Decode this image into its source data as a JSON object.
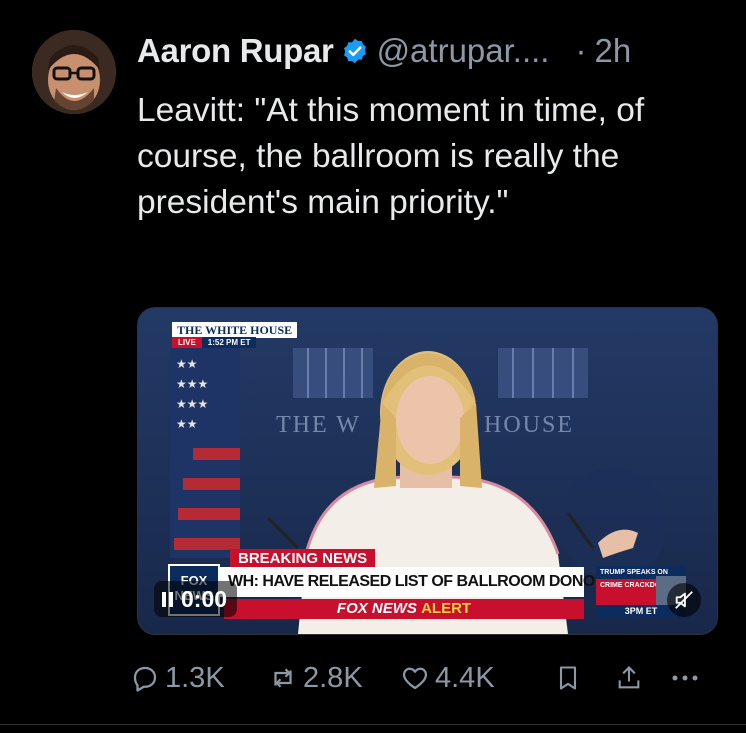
{
  "author": {
    "name": "Aaron Rupar",
    "handle": "@atrupar....",
    "separator": "·",
    "time": "2h"
  },
  "tweet": {
    "text": "Leavitt: \"At this moment in time, of course, the ballroom is really the president's main priority.\""
  },
  "video": {
    "chyron_top": "THE WHITE HOUSE",
    "live_label": "LIVE",
    "live_time": "1:52 PM ET",
    "breaking_label": "BREAKING NEWS",
    "headline": "WH: HAVE RELEASED LIST OF BALLROOM DONORS",
    "alert_prefix": "FOX NEWS",
    "alert_suffix": "ALERT",
    "network_logo": "FOX NEWS",
    "sidebox_line1": "TRUMP SPEAKS ON",
    "sidebox_line2": "CRIME CRACKDOWN",
    "sidebox_time": "3PM ET",
    "sign_left": "THE W",
    "sign_right": "HOUSE",
    "elapsed": "0:00"
  },
  "actions": {
    "replies": "1.3K",
    "reposts": "2.8K",
    "likes": "4.4K"
  },
  "colors": {
    "background": "#000000",
    "text": "#e7e9ea",
    "secondary": "#8b98a5",
    "verified": "#1d9bf0",
    "fox_red": "#c8102e",
    "fox_navy": "#0b2c5c"
  }
}
